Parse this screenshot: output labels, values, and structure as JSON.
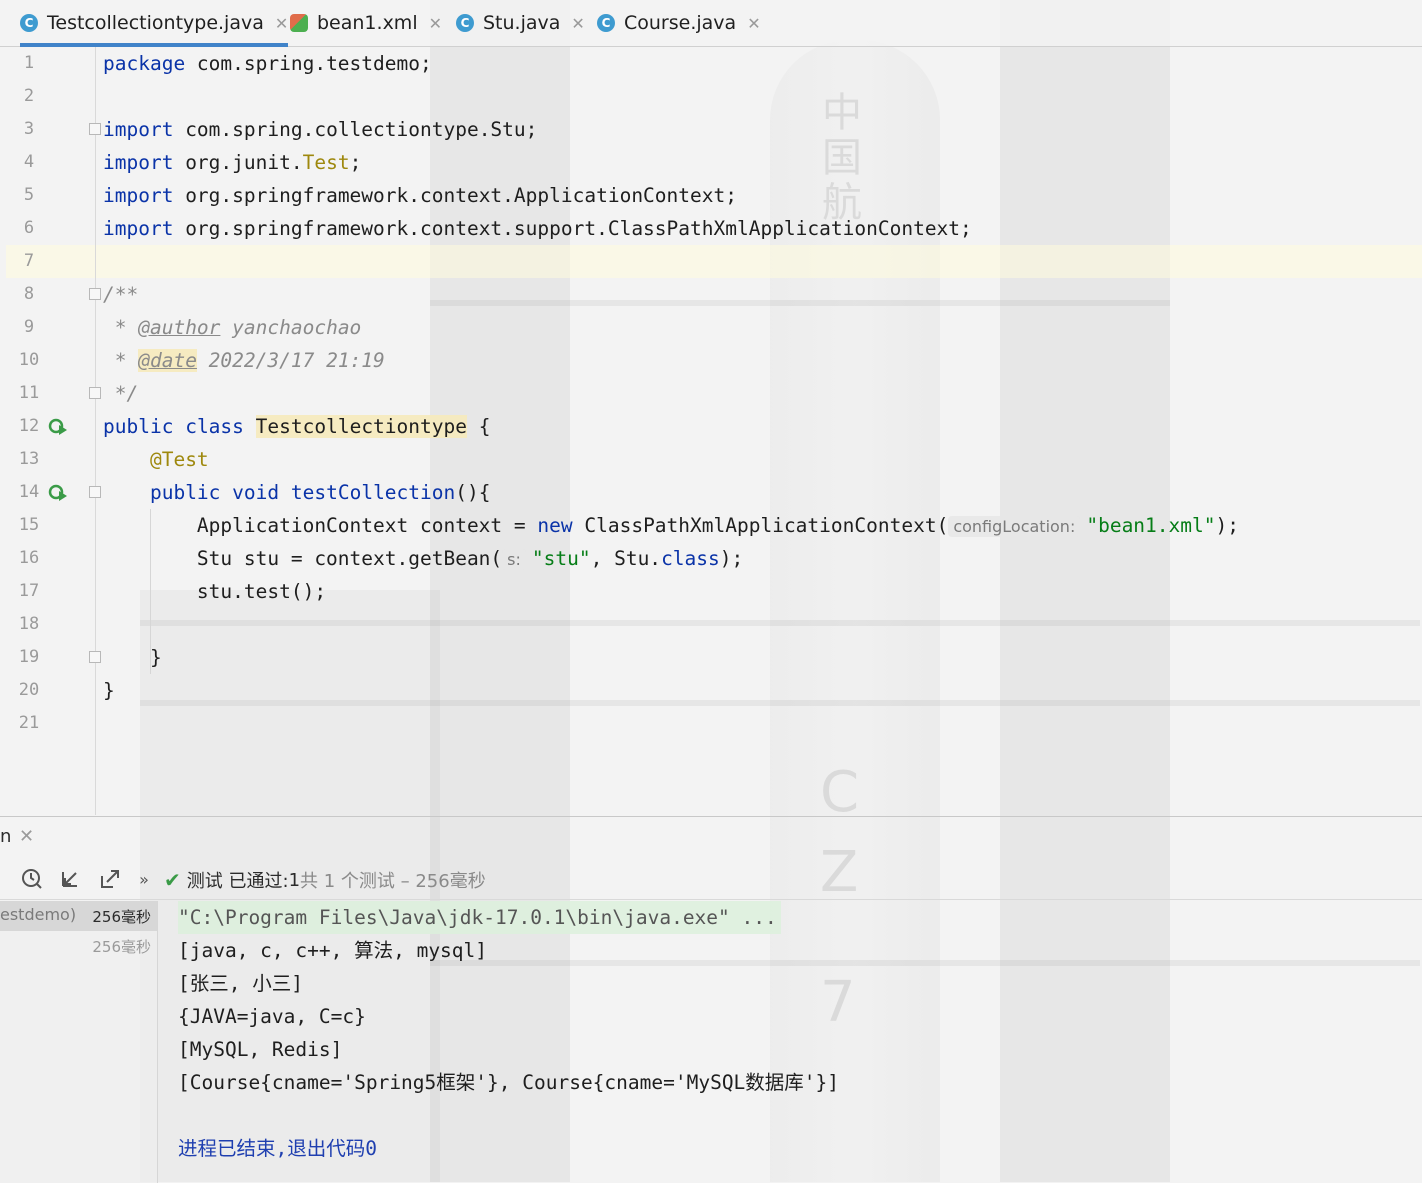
{
  "tabs": [
    {
      "label": "Testcollectiontype.java",
      "icon": "java-class-icon",
      "active": true
    },
    {
      "label": "bean1.xml",
      "icon": "xml-file-icon",
      "active": false
    },
    {
      "label": "Stu.java",
      "icon": "java-class-icon",
      "active": false
    },
    {
      "label": "Course.java",
      "icon": "java-class-icon",
      "active": false
    }
  ],
  "editor": {
    "line_numbers": [
      "1",
      "2",
      "3",
      "4",
      "5",
      "6",
      "7",
      "8",
      "9",
      "10",
      "11",
      "12",
      "13",
      "14",
      "15",
      "16",
      "17",
      "18",
      "19",
      "20",
      "21"
    ],
    "current_line": "7",
    "code": {
      "l1_kw": "package",
      "l1_rest": " com.spring.testdemo;",
      "l3_kw": "import",
      "l3_rest": " com.spring.collectiontype.Stu;",
      "l4_kw": "import",
      "l4_mid": " org.junit.",
      "l4_ann": "Test",
      "l4_end": ";",
      "l5_kw": "import",
      "l5_rest": " org.springframework.context.ApplicationContext;",
      "l6_kw": "import",
      "l6_rest": " org.springframework.context.support.ClassPathXmlApplicationContext;",
      "l8": "/**",
      "l9_star": " * ",
      "l9_tag": "@author",
      "l9_val": " yanchaochao",
      "l10_star": " * ",
      "l10_tag": "@date",
      "l10_val": " 2022/3/17 21:19",
      "l11": " */",
      "l12_kw1": "public",
      "l12_kw2": "class",
      "l12_name": "Testcollectiontype",
      "l12_end": " {",
      "l13_ann": "@Test",
      "l14_kw1": "public",
      "l14_kw2": "void",
      "l14_name": "testCollection",
      "l14_end": "(){",
      "l15_a": "ApplicationContext context = ",
      "l15_new": "new",
      "l15_b": " ClassPathXmlApplicationContext(",
      "l15_hint": "configLocation:",
      "l15_str": "\"bean1.xml\"",
      "l15_end": ");",
      "l16_a": "Stu stu = context.getBean(",
      "l16_hint": "s:",
      "l16_str": "\"stu\"",
      "l16_b": ", Stu.",
      "l16_kw": "class",
      "l16_end": ");",
      "l17": "stu.test();",
      "l19": "}",
      "l20": "}"
    }
  },
  "run_panel": {
    "title": "n",
    "status": {
      "prefix": "测试 已通过: ",
      "count": "1",
      "detail": "共 1 个测试 – 256毫秒"
    },
    "toolbar": [
      "history-icon",
      "collapse-icon",
      "export-icon",
      "more-icon"
    ],
    "tree": [
      {
        "name": "estdemo)",
        "time": "256毫秒",
        "selected": true
      },
      {
        "name": "",
        "time": "256毫秒",
        "selected": false
      }
    ],
    "console": [
      "\"C:\\Program Files\\Java\\jdk-17.0.1\\bin\\java.exe\" ...",
      "[java, c, c++, 算法, mysql]",
      "[张三, 小三]",
      "{JAVA=java, C=c}",
      "[MySQL, Redis]",
      "[Course{cname='Spring5框架'}, Course{cname='MySQL数据库'}]",
      "",
      "进程已结束,退出代码0"
    ]
  },
  "colors": {
    "keyword": "#0a33a8",
    "string": "#067d17",
    "annotation": "#9e880d",
    "comment": "#8a8a8a",
    "pass": "#3a9b47",
    "tab_underline": "#4083c9"
  }
}
